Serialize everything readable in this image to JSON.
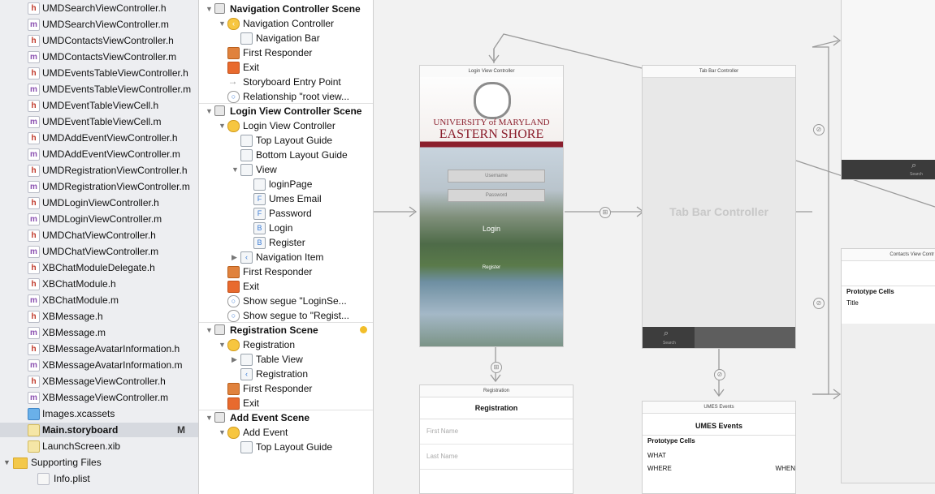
{
  "navigator": {
    "files": [
      {
        "name": "UMDSearchViewController.h",
        "kind": "h"
      },
      {
        "name": "UMDSearchViewController.m",
        "kind": "m"
      },
      {
        "name": "UMDContactsViewController.h",
        "kind": "h"
      },
      {
        "name": "UMDContactsViewController.m",
        "kind": "m"
      },
      {
        "name": "UMDEventsTableViewController.h",
        "kind": "h"
      },
      {
        "name": "UMDEventsTableViewController.m",
        "kind": "m"
      },
      {
        "name": "UMDEventTableViewCell.h",
        "kind": "h"
      },
      {
        "name": "UMDEventTableViewCell.m",
        "kind": "m"
      },
      {
        "name": "UMDAddEventViewController.h",
        "kind": "h"
      },
      {
        "name": "UMDAddEventViewController.m",
        "kind": "m"
      },
      {
        "name": "UMDRegistrationViewController.h",
        "kind": "h"
      },
      {
        "name": "UMDRegistrationViewController.m",
        "kind": "m"
      },
      {
        "name": "UMDLoginViewController.h",
        "kind": "h"
      },
      {
        "name": "UMDLoginViewController.m",
        "kind": "m"
      },
      {
        "name": "UMDChatViewController.h",
        "kind": "h"
      },
      {
        "name": "UMDChatViewController.m",
        "kind": "m"
      },
      {
        "name": "XBChatModuleDelegate.h",
        "kind": "h"
      },
      {
        "name": "XBChatModule.h",
        "kind": "h"
      },
      {
        "name": "XBChatModule.m",
        "kind": "m"
      },
      {
        "name": "XBMessage.h",
        "kind": "h"
      },
      {
        "name": "XBMessage.m",
        "kind": "m"
      },
      {
        "name": "XBMessageAvatarInformation.h",
        "kind": "h"
      },
      {
        "name": "XBMessageAvatarInformation.m",
        "kind": "m"
      },
      {
        "name": "XBMessageViewController.h",
        "kind": "h"
      },
      {
        "name": "XBMessageViewController.m",
        "kind": "m"
      },
      {
        "name": "Images.xcassets",
        "kind": "asset"
      },
      {
        "name": "Main.storyboard",
        "kind": "sb",
        "flag": "M"
      },
      {
        "name": "LaunchScreen.xib",
        "kind": "xib"
      },
      {
        "name": "Supporting Files",
        "kind": "folder"
      },
      {
        "name": "Info.plist",
        "kind": "plist"
      }
    ],
    "badges": {
      "h": "h",
      "m": "m"
    }
  },
  "outline": {
    "rows": [
      {
        "label": "Navigation Controller Scene",
        "indent": 0,
        "icon": "scene",
        "tri": "▼",
        "bold": true
      },
      {
        "label": "Navigation Controller",
        "indent": 1,
        "icon": "yellow",
        "tri": "▼",
        "glyph": "‹"
      },
      {
        "label": "Navigation Bar",
        "indent": 2,
        "icon": "box"
      },
      {
        "label": "First Responder",
        "indent": 1,
        "icon": "cube"
      },
      {
        "label": "Exit",
        "indent": 1,
        "icon": "exit"
      },
      {
        "label": "Storyboard Entry Point",
        "indent": 1,
        "icon": "arrow",
        "glyph": "→"
      },
      {
        "label": "Relationship \"root view...",
        "indent": 1,
        "icon": "circle",
        "glyph": "○"
      },
      {
        "label": "Login View Controller Scene",
        "indent": 0,
        "icon": "scene",
        "tri": "▼",
        "bold": true,
        "sep": true
      },
      {
        "label": "Login View Controller",
        "indent": 1,
        "icon": "yellow",
        "tri": "▼"
      },
      {
        "label": "Top Layout Guide",
        "indent": 2,
        "icon": "box"
      },
      {
        "label": "Bottom Layout Guide",
        "indent": 2,
        "icon": "box"
      },
      {
        "label": "View",
        "indent": 2,
        "icon": "box",
        "tri": "▼"
      },
      {
        "label": "loginPage",
        "indent": 3,
        "icon": "box"
      },
      {
        "label": "Umes Email",
        "indent": 3,
        "icon": "box",
        "glyph": "F"
      },
      {
        "label": "Password",
        "indent": 3,
        "icon": "box",
        "glyph": "F"
      },
      {
        "label": "Login",
        "indent": 3,
        "icon": "box",
        "glyph": "B"
      },
      {
        "label": "Register",
        "indent": 3,
        "icon": "box",
        "glyph": "B"
      },
      {
        "label": "Navigation Item",
        "indent": 2,
        "icon": "box",
        "tri": "▶",
        "glyph": "‹"
      },
      {
        "label": "First Responder",
        "indent": 1,
        "icon": "cube"
      },
      {
        "label": "Exit",
        "indent": 1,
        "icon": "exit"
      },
      {
        "label": "Show segue \"LoginSe...",
        "indent": 1,
        "icon": "circle",
        "glyph": "○"
      },
      {
        "label": "Show segue to \"Regist...",
        "indent": 1,
        "icon": "circle",
        "glyph": "○"
      },
      {
        "label": "Registration Scene",
        "indent": 0,
        "icon": "scene",
        "tri": "▼",
        "bold": true,
        "sep": true,
        "dot": true
      },
      {
        "label": "Registration",
        "indent": 1,
        "icon": "yellow",
        "tri": "▼"
      },
      {
        "label": "Table View",
        "indent": 2,
        "icon": "box",
        "tri": "▶"
      },
      {
        "label": "Registration",
        "indent": 2,
        "icon": "box",
        "glyph": "‹"
      },
      {
        "label": "First Responder",
        "indent": 1,
        "icon": "cube"
      },
      {
        "label": "Exit",
        "indent": 1,
        "icon": "exit"
      },
      {
        "label": "Add Event Scene",
        "indent": 0,
        "icon": "scene",
        "tri": "▼",
        "bold": true,
        "sep": true
      },
      {
        "label": "Add Event",
        "indent": 1,
        "icon": "yellow",
        "tri": "▼"
      },
      {
        "label": "Top Layout Guide",
        "indent": 2,
        "icon": "box"
      }
    ]
  },
  "canvas": {
    "login": {
      "title": "Login View Controller",
      "univ_line1": "UNIVERSITY of MARYLAND",
      "univ_line2": "EASTERN SHORE",
      "username_placeholder": "Username",
      "password_placeholder": "Password",
      "login_label": "Login",
      "register_label": "Register"
    },
    "tabbar": {
      "title": "Tab Bar Controller",
      "center_label": "Tab Bar Controller",
      "tab_label": "Search"
    },
    "search_partial": {
      "tab_label": "Search"
    },
    "registration": {
      "title": "Registration",
      "nav_title": "Registration",
      "fields": [
        "First Name",
        "Last Name"
      ]
    },
    "events": {
      "title": "UMES Events",
      "nav_title": "UMES Events",
      "prototype": "Prototype Cells",
      "what": "WHAT",
      "where": "WHERE",
      "when": "WHEN"
    },
    "contacts": {
      "title": "Contacts View Contr",
      "prototype": "Prototype Cells",
      "row": "Title"
    }
  }
}
